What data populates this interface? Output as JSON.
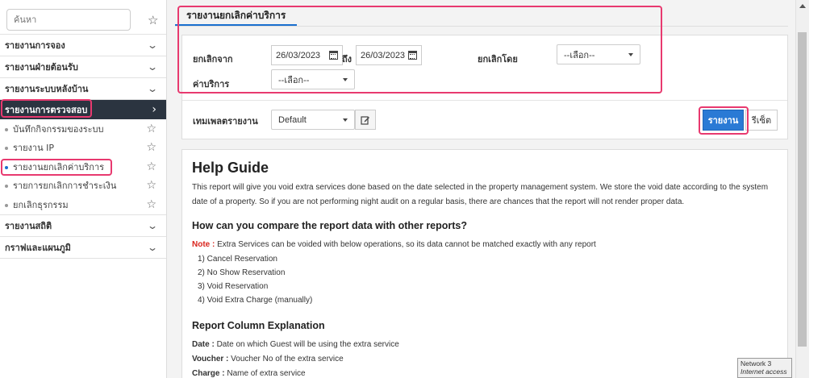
{
  "sidebar": {
    "search_placeholder": "ค้นหา",
    "menu_top": [
      {
        "label": "รายงานการจอง"
      },
      {
        "label": "รายงานฝ่ายต้อนรับ"
      },
      {
        "label": "รายงานระบบหลังบ้าน"
      }
    ],
    "active_menu": {
      "label": "รายงานการตรวจสอบ"
    },
    "sub_items": [
      {
        "label": "บันทึกกิจกรรมของระบบ"
      },
      {
        "label": "รายงาน IP"
      },
      {
        "label": "รายงานยกเลิกค่าบริการ"
      },
      {
        "label": "รายการยกเลิกการชำระเงิน"
      },
      {
        "label": "ยกเลิกธุรกรรม"
      }
    ],
    "menu_bottom": [
      {
        "label": "รายงานสถิติ"
      },
      {
        "label": "กราฟและแผนภูมิ"
      }
    ]
  },
  "tab": {
    "label": "รายงานยกเลิกค่าบริการ"
  },
  "filters": {
    "void_from_label": "ยกเลิกจาก",
    "date_from": "26/03/2023",
    "to_label": "ถึง",
    "date_to": "26/03/2023",
    "void_by_label": "ยกเลิกโดย",
    "void_by_value": "--เลือก--",
    "service_label": "ค่าบริการ",
    "service_value": "--เลือก--",
    "template_label": "เทมเพลตรายงาน",
    "template_value": "Default",
    "report_button": "รายงาน",
    "reset_button": "รีเซ็ต"
  },
  "help": {
    "title": "Help Guide",
    "intro": "This report will give you void extra services done based on the date selected in the property management system. We store the void date according to the system date of a property. So if you are not performing night audit on a regular basis, there are chances that the report will not render proper data.",
    "compare_heading": "How can you compare the report data with other reports?",
    "note_label": "Note :",
    "note_text": " Extra Services can be voided with below operations, so its data cannot be matched exactly with any report",
    "list": [
      "1) Cancel Reservation",
      "2) No Show Reservation",
      "3) Void Reservation",
      "4) Void Extra Charge (manually)"
    ],
    "columns_heading": "Report Column Explanation",
    "columns": [
      {
        "name": "Date :",
        "desc": " Date on which Guest will be using the extra service"
      },
      {
        "name": "Voucher :",
        "desc": " Voucher No of the extra service"
      },
      {
        "name": "Charge :",
        "desc": " Name of extra service"
      }
    ]
  },
  "network_tooltip": {
    "line1": "Network  3",
    "line2": "Internet access"
  },
  "colors": {
    "accent": "#2a7ad5",
    "highlight": "#e8396f",
    "active_menu_bg": "#2b3440",
    "note": "#d9241c"
  }
}
